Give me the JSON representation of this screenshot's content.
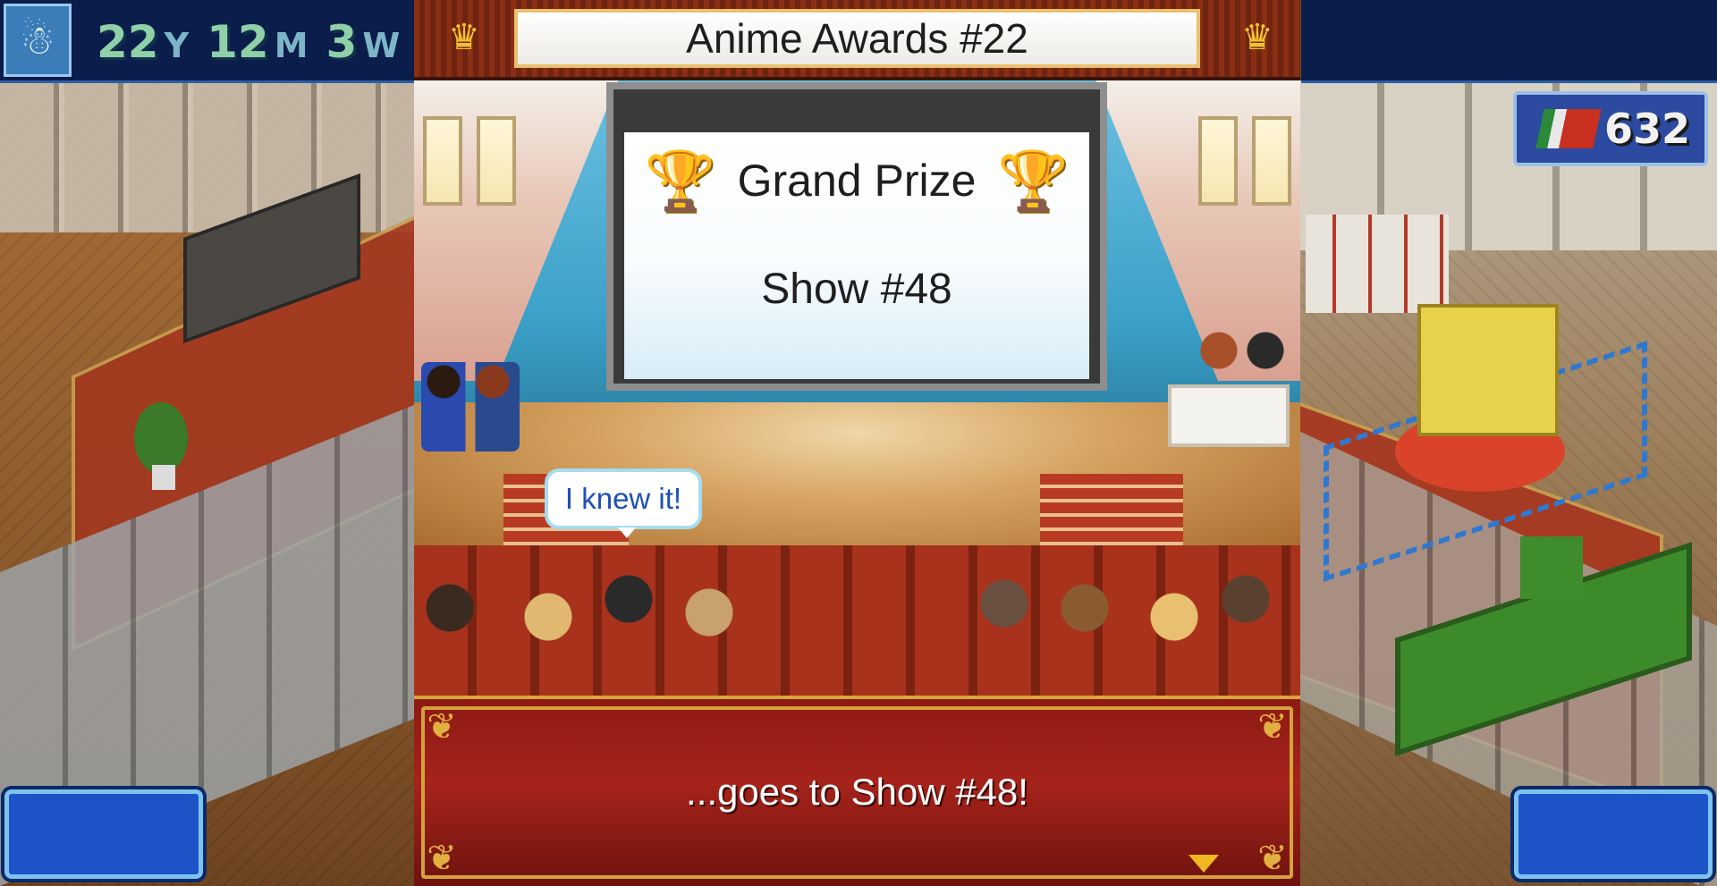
{
  "hud": {
    "avatar_icon": "☃",
    "date": {
      "years": "22",
      "years_unit": "Y",
      "months": "12",
      "months_unit": "M",
      "weeks": "3",
      "weeks_unit": "W"
    },
    "points": "632"
  },
  "award": {
    "title": "Anime Awards #22",
    "prize": "Grand Prize",
    "winner": "Show #48",
    "speech_bubble": "I knew it!",
    "dialog": "...goes to Show #48!"
  },
  "colors": {
    "hud_bg": "#0b1d4a",
    "dialog_bg": "#a5231a",
    "gold": "#f0be28",
    "bubble_text": "#1d4fb8"
  }
}
